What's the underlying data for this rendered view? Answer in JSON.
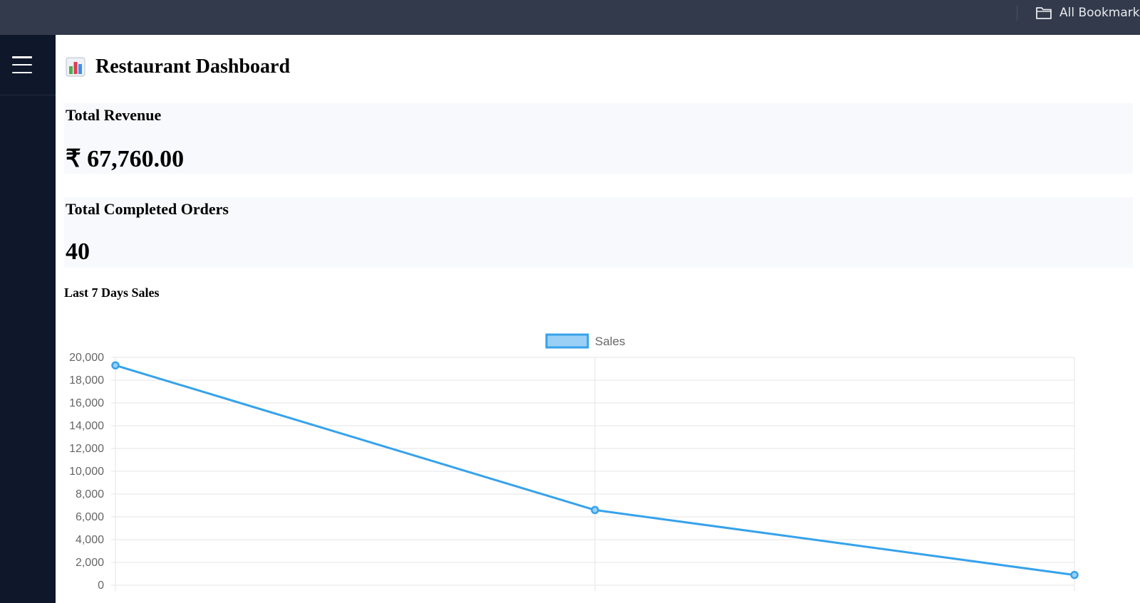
{
  "browser": {
    "bookmarks_label": "All Bookmarks"
  },
  "icons": {
    "menu": "hamburger-menu-icon",
    "folder": "folder-icon",
    "title": "bar-chart-emoji-icon"
  },
  "page": {
    "title": "Restaurant Dashboard"
  },
  "cards": {
    "revenue": {
      "label": "Total Revenue",
      "value": "₹ 67,760.00"
    },
    "orders": {
      "label": "Total Completed Orders",
      "value": "40"
    }
  },
  "colors": {
    "sidebar": "#0f172b",
    "browser_bar": "#323a4b",
    "card_bg": "#f8f9fc",
    "series_line": "#36a2eb",
    "series_fill": "#9ad0f5"
  },
  "chart_data": {
    "type": "line",
    "title": "Last 7 Days Sales",
    "xlabel": "",
    "ylabel": "",
    "ylim": [
      0,
      20000
    ],
    "yticks": [
      0,
      2000,
      4000,
      6000,
      8000,
      10000,
      12000,
      14000,
      16000,
      18000,
      20000
    ],
    "legend_position": "top-center",
    "grid": true,
    "series": [
      {
        "name": "Sales",
        "values": [
          19300,
          6600,
          900
        ]
      }
    ]
  }
}
